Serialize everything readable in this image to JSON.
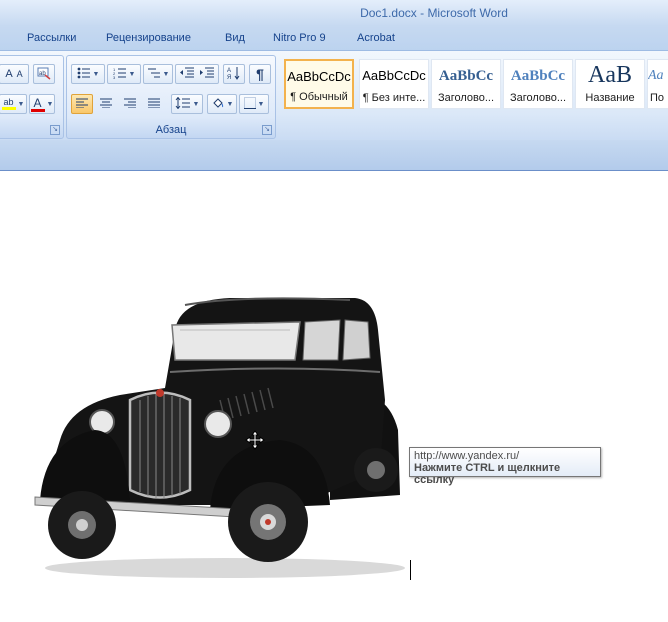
{
  "window": {
    "title": "Doc1.docx - Microsoft Word"
  },
  "tabs": [
    {
      "label": "Рассылки"
    },
    {
      "label": "Рецензирование"
    },
    {
      "label": "Вид"
    },
    {
      "label": "Nitro Pro 9"
    },
    {
      "label": "Acrobat"
    }
  ],
  "ribbon": {
    "font_group": {
      "grow_label": "A",
      "shrink_label": "A",
      "highlight_label": "ab",
      "font_color_label": "A"
    },
    "paragraph_group": {
      "label": "Абзац"
    },
    "styles": [
      {
        "sample": "AaBbCcDc",
        "name": "¶ Обычный"
      },
      {
        "sample": "AaBbCcDc",
        "name": "¶ Без инте..."
      },
      {
        "sample": "AaBbCc",
        "name": "Заголово..."
      },
      {
        "sample": "AaBbCc",
        "name": "Заголово..."
      },
      {
        "sample": "AaB",
        "name": "Название"
      },
      {
        "sample": "Aa",
        "name": "По"
      }
    ]
  },
  "document": {
    "tooltip": {
      "url": "http://www.yandex.ru/",
      "hint": "Нажмите CTRL и щелкните ссылку"
    }
  },
  "colors": {
    "ribbon_bg": "#dbe8f8",
    "tab_text": "#15428b",
    "selected_style_border": "#f3b24d",
    "font_color_bar": "#e00000",
    "highlight_bar": "#ffff00"
  }
}
